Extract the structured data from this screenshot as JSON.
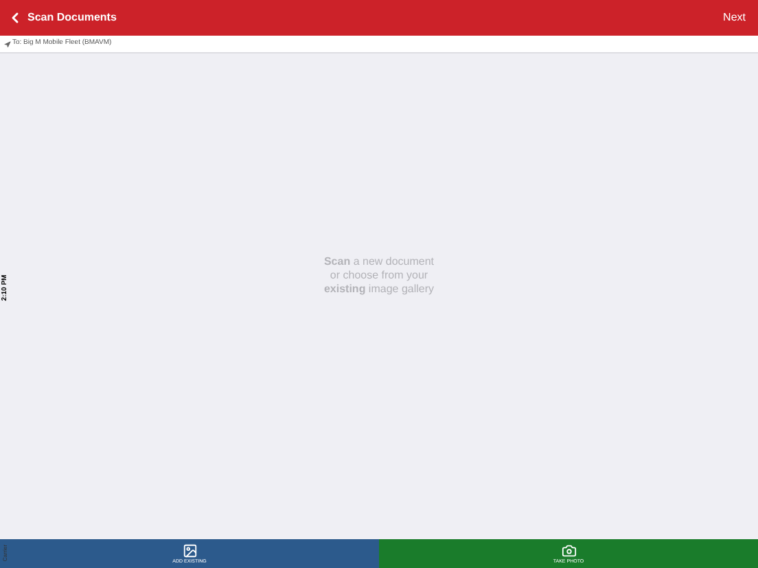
{
  "status_bar": {
    "time": "2:10 PM",
    "carrier": "Carrier"
  },
  "nav_bar": {
    "back_title": "Scan Documents",
    "action": "Next"
  },
  "recipient": "To: Big M Mobile Fleet (BMAVM)",
  "message": [
    "**Scan** a new document",
    "or choose from your",
    "**existing** image gallery"
  ],
  "bottom_actions": [
    {
      "kind": "gallery",
      "label": "ADD EXISTING"
    },
    {
      "kind": "camera",
      "label": "TAKE PHOTO"
    }
  ]
}
